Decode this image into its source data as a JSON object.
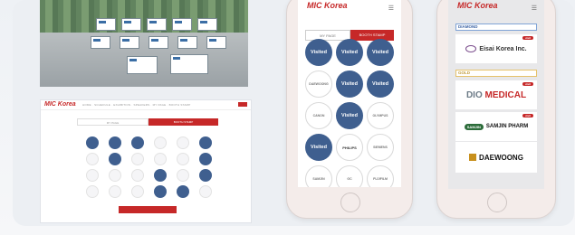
{
  "colors": {
    "brand_red": "#c62828",
    "visited_blue": "#3f5f8f"
  },
  "desktop": {
    "logo": "MIC Korea",
    "nav_text": "HOME · SCHEDULE · EXHIBITION · SPEAKERS · MY PAGE · BOOTH STAMP",
    "tabs": [
      "MY PAGE",
      "BOOTH STAMP"
    ]
  },
  "mobile_stamp": {
    "logo": "MIC Korea",
    "menu_icon": "hamburger-icon",
    "tabs": [
      "MY PAGE",
      "BOOTH STAMP"
    ],
    "stamps": [
      {
        "label": "Visited",
        "visited": true
      },
      {
        "label": "Visited",
        "visited": true
      },
      {
        "label": "Visited",
        "visited": true
      },
      {
        "label": "DAEWOONG",
        "visited": false
      },
      {
        "label": "Visited",
        "visited": true
      },
      {
        "label": "Visited",
        "visited": true
      },
      {
        "label": "CANON",
        "visited": false
      },
      {
        "label": "Visited",
        "visited": true
      },
      {
        "label": "OLYMPUS",
        "visited": false
      },
      {
        "label": "Visited",
        "visited": true
      },
      {
        "label": "PHILIPS",
        "visited": false
      },
      {
        "label": "SIEMENS",
        "visited": false
      },
      {
        "label": "SAMJIN",
        "visited": false
      },
      {
        "label": "GC",
        "visited": false
      },
      {
        "label": "FUJIFILM",
        "visited": false
      },
      {
        "label": "Visited",
        "visited": true
      },
      {
        "label": "konofi",
        "visited": false
      },
      {
        "label": "Visited",
        "visited": true
      }
    ]
  },
  "mobile_sponsor": {
    "logo": "MIC Korea",
    "menu_icon": "hamburger-icon",
    "tier_diamond": "DIAMOND",
    "tier_gold": "GOLD",
    "visit_label": "visit",
    "sponsors": {
      "eisai": "Eisai Korea Inc.",
      "dio_a": "DIO",
      "dio_b": "MEDICAL",
      "samjin_pill": "SAMJIN",
      "samjin_text": "SAMJIN PHARM",
      "daewoong": "DAEWOONG"
    }
  }
}
